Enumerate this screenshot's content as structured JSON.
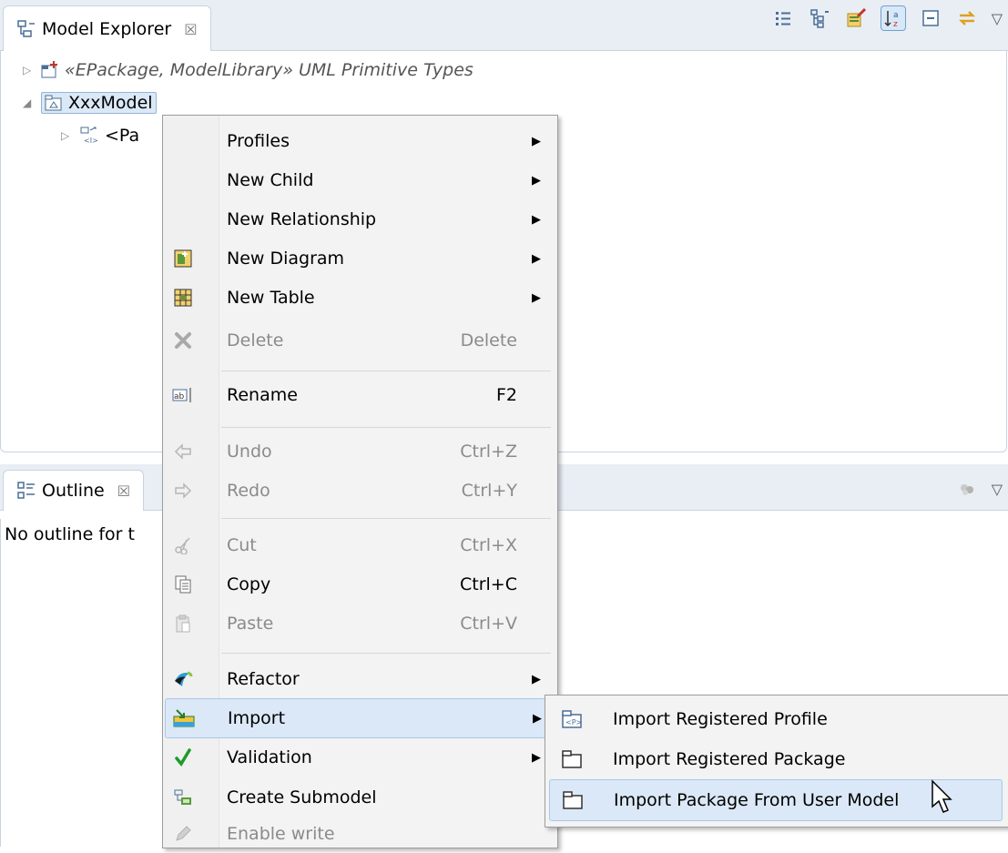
{
  "model_explorer": {
    "title": "Model Explorer",
    "close_glyph": "☒",
    "toolbar_icons": [
      "show-flat-icon",
      "show-hierarchy-icon",
      "link-editor-icon",
      "sort-alpha-icon",
      "collapse-all-icon",
      "sync-icon"
    ],
    "view_menu_glyph": "▽",
    "tree": [
      {
        "label": "«EPackage, ModelLibrary» UML Primitive Types",
        "expanded": false
      },
      {
        "label": "XxxModel",
        "expanded": true,
        "selected": true
      },
      {
        "label": "<Pa",
        "expanded": false
      }
    ]
  },
  "outline": {
    "title": "Outline",
    "close_glyph": "☒",
    "view_menu_glyph": "▽",
    "message": "No outline for t"
  },
  "context_menu": {
    "items": [
      {
        "label": "Profiles",
        "accel": "",
        "submenu": true,
        "disabled": false,
        "icon": ""
      },
      {
        "label": "New Child",
        "accel": "",
        "submenu": true,
        "disabled": false,
        "icon": ""
      },
      {
        "label": "New Relationship",
        "accel": "",
        "submenu": true,
        "disabled": false,
        "icon": ""
      },
      {
        "label": "New Diagram",
        "accel": "",
        "submenu": true,
        "disabled": false,
        "icon": "new-diagram-icon"
      },
      {
        "label": "New Table",
        "accel": "",
        "submenu": true,
        "disabled": false,
        "icon": "new-table-icon"
      },
      {
        "label": "Delete",
        "accel": "Delete",
        "submenu": false,
        "disabled": true,
        "icon": "delete-icon"
      },
      {
        "label": "Rename",
        "accel": "F2",
        "submenu": false,
        "disabled": false,
        "icon": "rename-icon"
      },
      {
        "label": "Undo",
        "accel": "Ctrl+Z",
        "submenu": false,
        "disabled": true,
        "icon": "undo-icon"
      },
      {
        "label": "Redo",
        "accel": "Ctrl+Y",
        "submenu": false,
        "disabled": true,
        "icon": "redo-icon"
      },
      {
        "label": "Cut",
        "accel": "Ctrl+X",
        "submenu": false,
        "disabled": true,
        "icon": "cut-icon"
      },
      {
        "label": "Copy",
        "accel": "Ctrl+C",
        "submenu": false,
        "disabled": false,
        "icon": "copy-icon"
      },
      {
        "label": "Paste",
        "accel": "Ctrl+V",
        "submenu": false,
        "disabled": true,
        "icon": "paste-icon"
      },
      {
        "label": "Refactor",
        "accel": "",
        "submenu": true,
        "disabled": false,
        "icon": "refactor-icon"
      },
      {
        "label": "Import",
        "accel": "",
        "submenu": true,
        "disabled": false,
        "icon": "import-icon",
        "highlighted": true
      },
      {
        "label": "Validation",
        "accel": "",
        "submenu": true,
        "disabled": false,
        "icon": "validation-check-icon"
      },
      {
        "label": "Create Submodel",
        "accel": "",
        "submenu": false,
        "disabled": false,
        "icon": "create-submodel-icon"
      },
      {
        "label": "Enable write",
        "accel": "",
        "submenu": false,
        "disabled": true,
        "icon": "pencil-icon"
      }
    ],
    "submenu_arrow": "▶"
  },
  "import_submenu": {
    "items": [
      {
        "label": "Import Registered Profile",
        "icon": "profile-package-icon"
      },
      {
        "label": "Import Registered Package",
        "icon": "package-icon"
      },
      {
        "label": "Import Package From User Model",
        "icon": "package-icon",
        "highlighted": true
      }
    ]
  },
  "colors": {
    "selection": "#dbe8f7",
    "selection_border": "#a8c8ea",
    "tab_bar": "#e9eef5",
    "disabled_text": "#8b8b8b"
  }
}
